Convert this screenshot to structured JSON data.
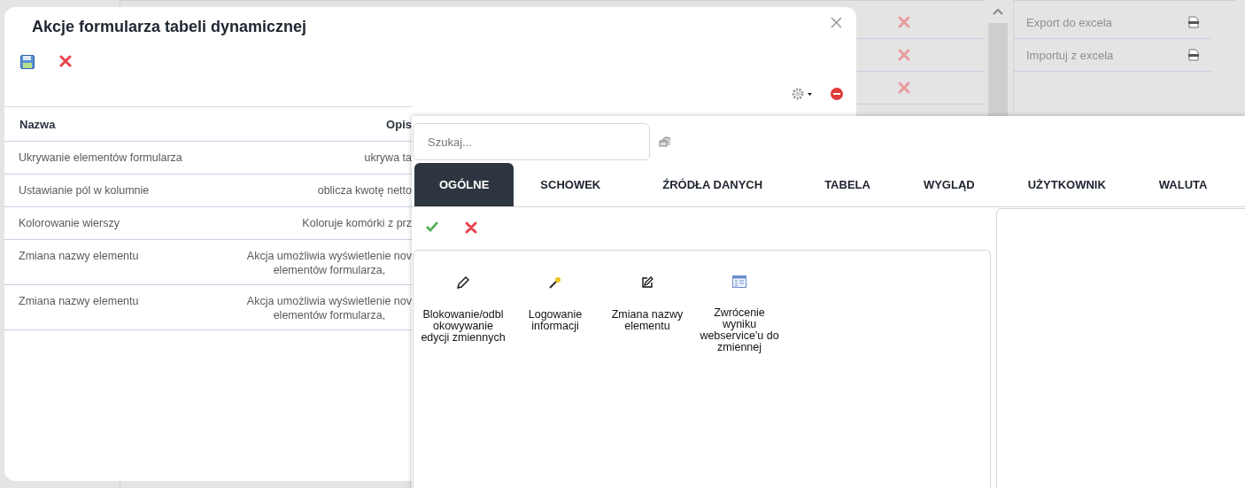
{
  "side_menu": [
    {
      "label": "Export do excela"
    },
    {
      "label": "Importuj z excela"
    }
  ],
  "dialog": {
    "title": "Akcje formularza tabeli dynamicznej",
    "table": {
      "columns": [
        "Nazwa",
        "Opis"
      ],
      "rows": [
        {
          "name": "Ukrywanie elementów formularza",
          "description": "ukrywa ta"
        },
        {
          "name": "Ustawianie pól w kolumnie",
          "description": "oblicza kwotę netto"
        },
        {
          "name": "Kolorowanie wierszy",
          "description": "Koloruje komórki z prz"
        },
        {
          "name": "Zmiana nazwy elementu",
          "description": "Akcja umożliwia wyświetlenie nov\nelementów formularza,"
        },
        {
          "name": "Zmiana nazwy elementu",
          "description": "Akcja umożliwia wyświetlenie nov\nelementów formularza,"
        }
      ]
    }
  },
  "panel": {
    "search": {
      "placeholder": "Szukaj..."
    },
    "tabs": [
      {
        "label": "OGÓLNE",
        "selected": true
      },
      {
        "label": "SCHOWEK",
        "selected": false
      },
      {
        "label": "ŹRÓDŁA DANYCH",
        "selected": false
      },
      {
        "label": "TABELA",
        "selected": false
      },
      {
        "label": "WYGLĄD",
        "selected": false
      },
      {
        "label": "UŻYTKOWNIK",
        "selected": false
      },
      {
        "label": "WALUTA",
        "selected": false
      }
    ],
    "actions": [
      {
        "kind": "pencil",
        "label": "Blokowanie/odblokowywanie edycji zmiennych"
      },
      {
        "kind": "wand",
        "label": "Logowanie informacji"
      },
      {
        "kind": "edit",
        "label": "Zmiana nazwy elementu"
      },
      {
        "kind": "form",
        "label": "Zwrócenie wyniku webservice'u do zmiennej"
      }
    ]
  }
}
